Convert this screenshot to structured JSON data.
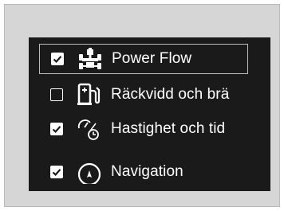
{
  "menu": {
    "items": [
      {
        "label": "Power Flow",
        "checked": true,
        "icon": "power-flow-icon"
      },
      {
        "label": "Räckvidd och brä",
        "checked": false,
        "icon": "fuel-range-icon"
      },
      {
        "label": "Hastighet och tid",
        "checked": true,
        "icon": "speed-time-icon"
      },
      {
        "label": "Navigation",
        "checked": true,
        "icon": "navigation-icon"
      }
    ]
  }
}
